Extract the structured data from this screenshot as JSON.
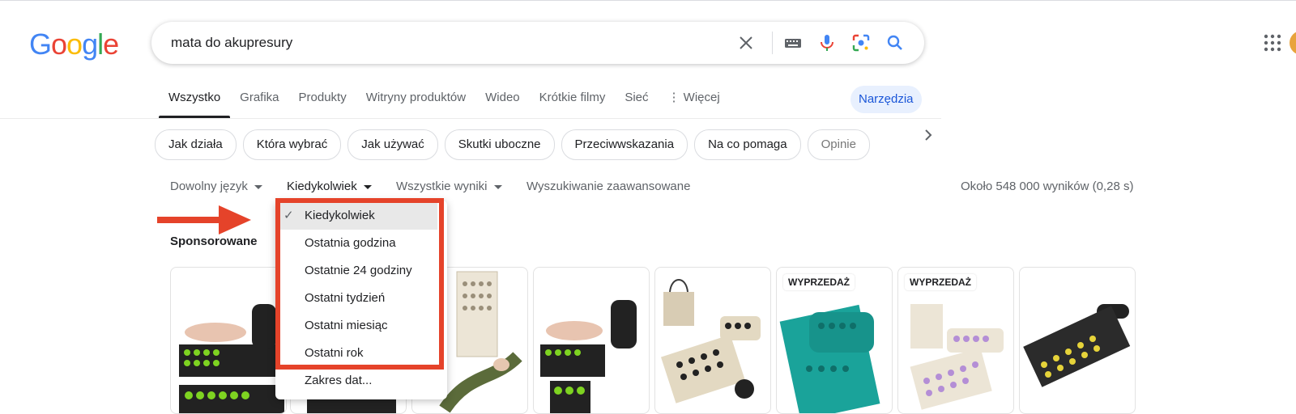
{
  "logo": {
    "letters": [
      "G",
      "o",
      "o",
      "g",
      "l",
      "e"
    ],
    "colors": [
      "#4285f4",
      "#ea4335",
      "#fbbc05",
      "#4285f4",
      "#34a853",
      "#ea4335"
    ]
  },
  "search": {
    "query": "mata do akupresury",
    "icons": [
      "close-icon",
      "keyboard-icon",
      "mic-icon",
      "lens-icon",
      "search-icon"
    ]
  },
  "tabs": [
    {
      "label": "Wszystko",
      "active": true
    },
    {
      "label": "Grafika"
    },
    {
      "label": "Produkty"
    },
    {
      "label": "Witryny produktów"
    },
    {
      "label": "Wideo"
    },
    {
      "label": "Krótkie filmy"
    },
    {
      "label": "Sieć"
    },
    {
      "label": "⋮ Więcej"
    }
  ],
  "tools_label": "Narzędzia",
  "chips": [
    "Jak działa",
    "Która wybrać",
    "Jak używać",
    "Skutki uboczne",
    "Przeciwwskazania",
    "Na co pomaga",
    "Opinie"
  ],
  "toolsbar": {
    "language": "Dowolny język",
    "time": "Kiedykolwiek",
    "results_filter": "Wszystkie wyniki",
    "advanced": "Wyszukiwanie zaawansowane",
    "stats": "Około 548 000 wyników (0,28 s)"
  },
  "sponsored_label": "Sponsorowane",
  "time_dropdown": {
    "items": [
      "Kiedykolwiek",
      "Ostatnia godzina",
      "Ostatnie 24 godziny",
      "Ostatni tydzień",
      "Ostatni miesiąc",
      "Ostatni rok",
      "Zakres dat..."
    ],
    "selected": "Kiedykolwiek"
  },
  "products": [
    {
      "badge": ""
    },
    {
      "badge": ""
    },
    {
      "badge": ""
    },
    {
      "badge": ""
    },
    {
      "badge": ""
    },
    {
      "badge": "WYPRZEDAŻ"
    },
    {
      "badge": "WYPRZEDAŻ"
    },
    {
      "badge": ""
    }
  ],
  "colors": {
    "accent_blue": "#1a73e8",
    "annotation_red": "#e5432a",
    "mat_green": "#7ed321"
  }
}
